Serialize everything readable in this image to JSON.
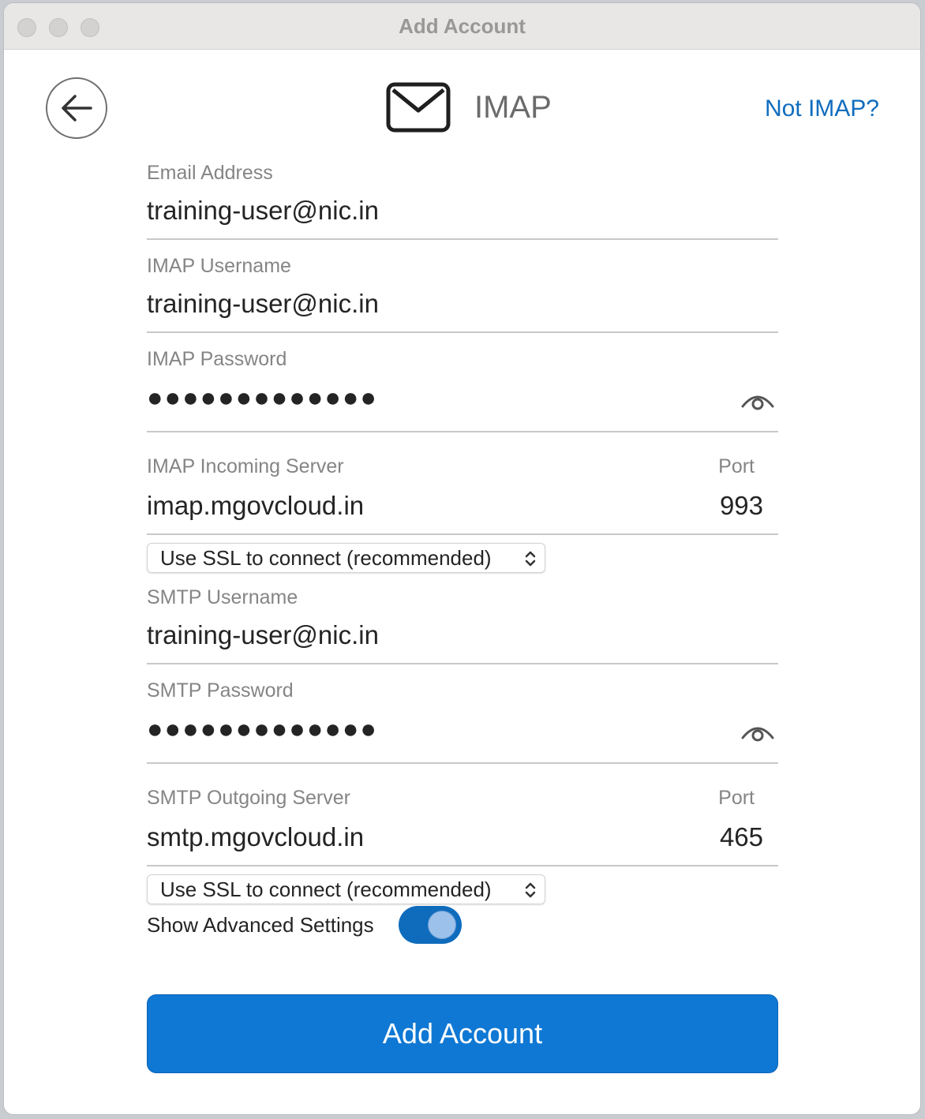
{
  "window": {
    "title": "Add Account"
  },
  "header": {
    "protocol": "IMAP",
    "not_imap_link": "Not IMAP?",
    "icons": {
      "back": "back-arrow-icon",
      "mail": "envelope-icon"
    }
  },
  "fields": {
    "email": {
      "label": "Email Address",
      "value": "training-user@nic.in"
    },
    "imap_username": {
      "label": "IMAP Username",
      "value": "training-user@nic.in"
    },
    "imap_password": {
      "label": "IMAP Password",
      "value": "●●●●●●●●●●●●●"
    },
    "imap_server": {
      "label": "IMAP Incoming Server",
      "value": "imap.mgovcloud.in",
      "port_label": "Port",
      "port": "993"
    },
    "imap_ssl": {
      "value": "Use SSL to connect (recommended)"
    },
    "smtp_username": {
      "label": "SMTP Username",
      "value": "training-user@nic.in"
    },
    "smtp_password": {
      "label": "SMTP Password",
      "value": "●●●●●●●●●●●●●"
    },
    "smtp_server": {
      "label": "SMTP Outgoing Server",
      "value": "smtp.mgovcloud.in",
      "port_label": "Port",
      "port": "465"
    },
    "smtp_ssl": {
      "value": "Use SSL to connect (recommended)"
    }
  },
  "advanced": {
    "label": "Show Advanced Settings",
    "enabled": true
  },
  "actions": {
    "add_account": "Add Account"
  },
  "colors": {
    "accent": "#0f78d4",
    "link": "#0f6cbd"
  }
}
